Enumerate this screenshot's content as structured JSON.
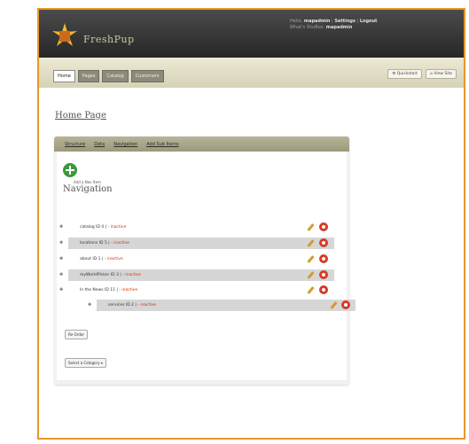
{
  "header": {
    "brand": "FreshPup",
    "user_line": "Hello, ",
    "username": "mapadmin",
    "sep1": " | ",
    "settings": "Settings",
    "sep2": " | ",
    "logout": "Logout",
    "site_line": "What's ShuBox: ",
    "site": "mapadmin"
  },
  "tabs": [
    "Home",
    "Pages",
    "Catalog",
    "Customers"
  ],
  "toolbar": {
    "quickstart": "Quickstart",
    "view_site": "View Site"
  },
  "page": {
    "title": "Home Page"
  },
  "panel": {
    "tabs": [
      "Structure",
      "Data",
      "Navigation",
      "Add Sub Items"
    ],
    "add_label": "Add a Nav Item",
    "nav_title": "Navigation",
    "rows": [
      {
        "label": "catalog ID 4 | - ",
        "action": "inactive"
      },
      {
        "label": "locations ID 5 | - ",
        "action": "inactive"
      },
      {
        "label": "about ID 1 | - ",
        "action": "inactive"
      },
      {
        "label": "myWorldPicker ID 3 | - ",
        "action": "inactive"
      },
      {
        "label": "In the News ID 11 | - ",
        "action": "inactive"
      },
      {
        "label": "services ID 2 | - ",
        "action": "inactive"
      }
    ],
    "reorder_btn": "Re-Order",
    "select_label": "Select a Category"
  },
  "colors": {
    "accent": "#e8962b",
    "delete": "#d83a2a",
    "add": "#3a9a3a"
  }
}
